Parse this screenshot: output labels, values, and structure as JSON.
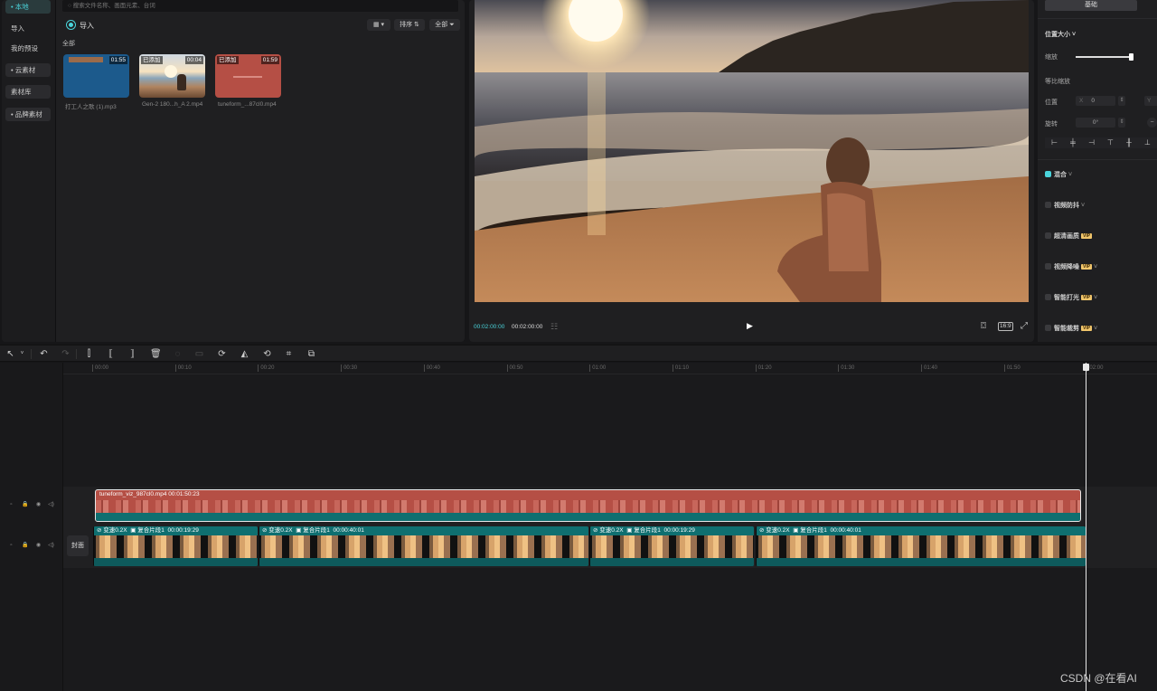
{
  "media_panel": {
    "categories": [
      {
        "label": "• 本地"
      },
      {
        "label": "导入"
      },
      {
        "label": "我的预设"
      },
      {
        "label": "• 云素材"
      },
      {
        "label": "素材库"
      },
      {
        "label": "• 品牌素材"
      }
    ],
    "search_placeholder": "搜索文件名称、画面元素、台词",
    "import_label": "导入",
    "view_toggle_label": "▾",
    "sort_label": "排序",
    "filter_label": "全部",
    "section_label": "全部",
    "items": [
      {
        "name": "打工人之歌 (1).mp3",
        "duration": "01:55",
        "tag": ""
      },
      {
        "name": "Gen-2 180...h_A 2.mp4",
        "duration": "00:04",
        "tag": "已添加"
      },
      {
        "name": "tuneform_...87cl0.mp4",
        "duration": "01:59",
        "tag": "已添加"
      }
    ]
  },
  "player": {
    "current_time": "00:02:00:00",
    "total_time": "00:02:00:00",
    "ratio_label": "16:9"
  },
  "properties": {
    "tab_basic": "基础",
    "position_size": "位置大小",
    "scale_label": "缩放",
    "uniform_scale": "等比缩放",
    "position_label": "位置",
    "pos_x_prefix": "X",
    "pos_x_value": "0",
    "pos_y_prefix": "Y",
    "rotate_label": "旋转",
    "rotate_value": "0°",
    "scale_level": 0.94,
    "sections": [
      {
        "label": "混合",
        "checked": true,
        "vip": false
      },
      {
        "label": "视频防抖",
        "checked": false,
        "vip": false
      },
      {
        "label": "超清画质",
        "checked": false,
        "vip": true
      },
      {
        "label": "视频降噪",
        "checked": false,
        "vip": true
      },
      {
        "label": "智能打光",
        "checked": false,
        "vip": true
      },
      {
        "label": "智能裁剪",
        "checked": false,
        "vip": true
      }
    ],
    "vip_label": "VIP"
  },
  "timeline": {
    "ruler": [
      "00:00",
      "00:10",
      "00:20",
      "00:30",
      "00:40",
      "00:50",
      "01:00",
      "01:10",
      "01:20",
      "01:30",
      "01:40",
      "01:50",
      "02:00"
    ],
    "audio_clip_label": "tuneform_viz_987cl0.mp4  00:01:50:23",
    "cover_label": "封面",
    "video_clips": [
      {
        "speed": "变速0.2X",
        "compound": "复合片段1",
        "duration": "00:00:19:29"
      },
      {
        "speed": "变速0.2X",
        "compound": "复合片段1",
        "duration": "00:00:40:01"
      },
      {
        "speed": "变速0.2X",
        "compound": "复合片段1",
        "duration": "00:00:19:29"
      },
      {
        "speed": "变速0.2X",
        "compound": "复合片段1",
        "duration": "00:00:40:01"
      }
    ]
  },
  "watermark": "CSDN @在看AI",
  "colors": {
    "accent": "#4ad4db",
    "audio_clip": "#b54f45",
    "video_clip": "#0e5a5c"
  }
}
